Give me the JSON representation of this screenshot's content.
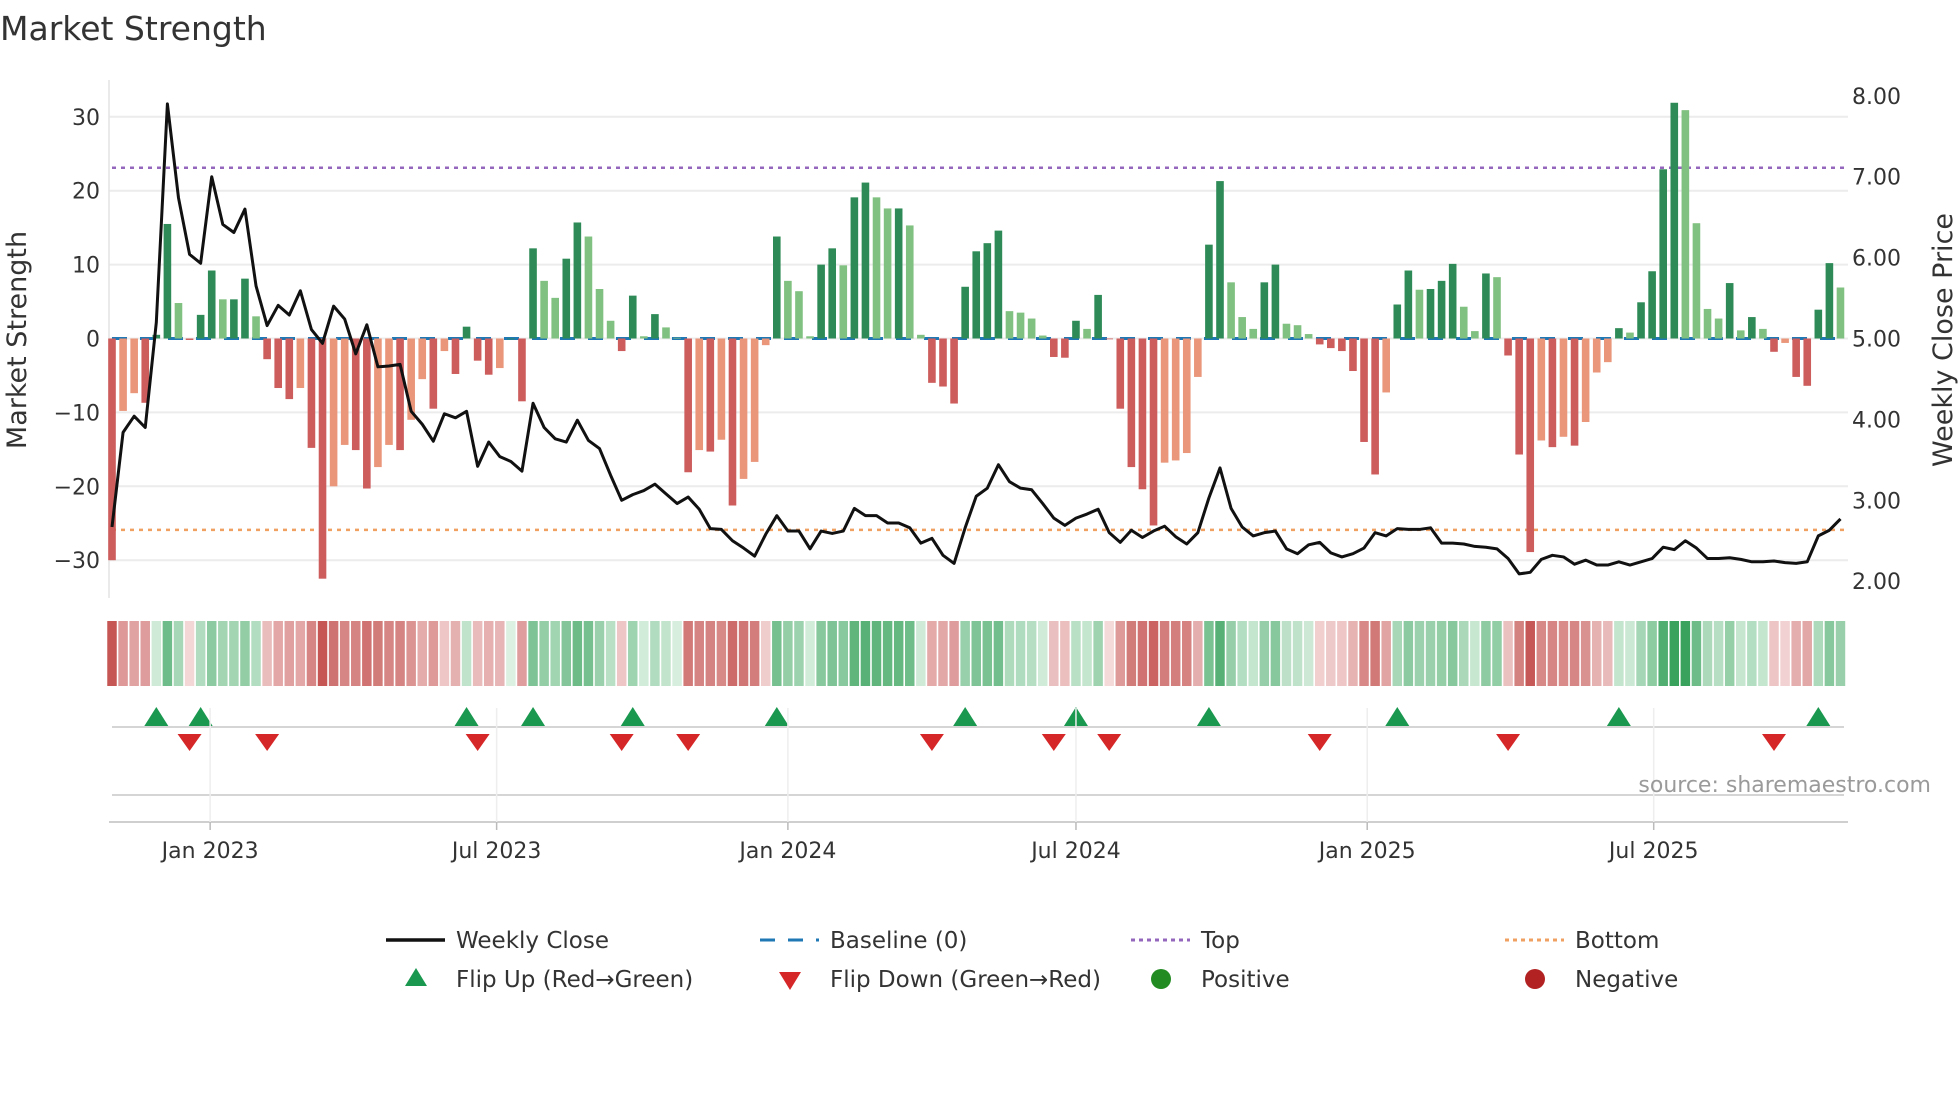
{
  "chart_data": {
    "type": "bar",
    "title": "Market Strength",
    "ylabel": "Market Strength",
    "y2label": "Weekly Close Price",
    "ylim": [
      -35,
      35
    ],
    "y2lim": [
      1.7,
      8.3
    ],
    "x_start_date": "2022-10-31",
    "x_interval": "weekly",
    "yticks": [
      30,
      20,
      10,
      0,
      -10,
      -20,
      -30
    ],
    "ytick_labels": [
      "30",
      "20",
      "10",
      "0",
      "−10",
      "−20",
      "−30"
    ],
    "y2ticks": [
      8,
      7,
      6,
      5,
      4,
      3,
      2
    ],
    "y2tick_labels": [
      "8.00",
      "7.00",
      "6.00",
      "5.00",
      "4.00",
      "3.00",
      "2.00"
    ],
    "xticks": [
      {
        "date": "2023-01-01",
        "label": "Jan 2023"
      },
      {
        "date": "2023-07-01",
        "label": "Jul 2023"
      },
      {
        "date": "2024-01-01",
        "label": "Jan 2024"
      },
      {
        "date": "2024-07-01",
        "label": "Jul 2024"
      },
      {
        "date": "2025-01-01",
        "label": "Jan 2025"
      },
      {
        "date": "2025-07-01",
        "label": "Jul 2025"
      }
    ],
    "top_level": 23.1,
    "bottom_level": -25.9,
    "baseline": 0,
    "strength": [
      -30,
      -9.8,
      -7.4,
      -8.7,
      0.5,
      15.5,
      4.8,
      -0.2,
      3.2,
      9.2,
      5.3,
      5.3,
      8.1,
      3.0,
      -2.8,
      -6.7,
      -8.2,
      -6.7,
      -14.8,
      -32.5,
      -20,
      -14.4,
      -15.1,
      -20.3,
      -17.4,
      -14.4,
      -15.1,
      -11,
      -5.5,
      -9.5,
      -1.7,
      -4.8,
      1.6,
      -3,
      -4.9,
      -4,
      0,
      -8.5,
      12.2,
      7.8,
      5.5,
      10.8,
      15.7,
      13.8,
      6.7,
      2.4,
      -1.7,
      5.8,
      0.3,
      3.3,
      1.5,
      0.1,
      -18.1,
      -15.1,
      -15.3,
      -13.7,
      -22.6,
      -19,
      -16.7,
      -0.9,
      13.8,
      7.8,
      6.4,
      0.3,
      10,
      12.2,
      9.9,
      19.1,
      21.1,
      19.1,
      17.6,
      17.6,
      15.3,
      0.5,
      -6.0,
      -6.5,
      -8.8,
      7.0,
      11.8,
      12.9,
      14.6,
      3.7,
      3.5,
      2.7,
      0.4,
      -2.5,
      -2.6,
      2.4,
      1.3,
      5.9,
      -0.1,
      -9.5,
      -17.4,
      -20.4,
      -25.3,
      -16.8,
      -16.5,
      -15.5,
      -5.2,
      12.7,
      21.3,
      7.6,
      2.9,
      1.3,
      7.6,
      10,
      2,
      1.8,
      0.6,
      -0.8,
      -1.3,
      -1.7,
      -4.4,
      -14,
      -18.4,
      -7.3,
      4.6,
      9.2,
      6.6,
      6.7,
      7.8,
      10.1,
      4.3,
      1,
      8.8,
      8.3,
      -2.3,
      -15.7,
      -28.9,
      -13.8,
      -14.7,
      -13.3,
      -14.5,
      -11.3,
      -4.6,
      -3.2,
      1.4,
      0.8,
      4.9,
      9.1,
      22.9,
      31.9,
      30.9,
      15.6,
      4,
      2.7,
      7.5,
      1.1,
      2.9,
      1.3,
      -1.8,
      -0.6,
      -5.2,
      -6.4,
      3.9,
      10.2,
      6.9
    ],
    "close": [
      2.67,
      3.84,
      4.04,
      3.9,
      5.2,
      7.9,
      6.74,
      6.04,
      5.93,
      7.0,
      6.41,
      6.31,
      6.6,
      5.65,
      5.16,
      5.41,
      5.29,
      5.59,
      5.11,
      4.94,
      5.4,
      5.24,
      4.81,
      5.17,
      4.65,
      4.66,
      4.68,
      4.1,
      3.94,
      3.73,
      4.07,
      4.02,
      4.1,
      3.42,
      3.72,
      3.54,
      3.48,
      3.36,
      4.2,
      3.9,
      3.76,
      3.72,
      3.99,
      3.74,
      3.64,
      3.31,
      3.0,
      3.07,
      3.12,
      3.2,
      3.08,
      2.96,
      3.04,
      2.89,
      2.65,
      2.64,
      2.5,
      2.41,
      2.31,
      2.58,
      2.81,
      2.62,
      2.62,
      2.4,
      2.62,
      2.59,
      2.62,
      2.9,
      2.81,
      2.81,
      2.72,
      2.72,
      2.66,
      2.47,
      2.53,
      2.32,
      2.22,
      2.66,
      3.05,
      3.15,
      3.44,
      3.23,
      3.15,
      3.13,
      2.96,
      2.78,
      2.69,
      2.78,
      2.83,
      2.89,
      2.6,
      2.48,
      2.63,
      2.54,
      2.62,
      2.68,
      2.55,
      2.46,
      2.6,
      3.03,
      3.4,
      2.9,
      2.67,
      2.56,
      2.6,
      2.62,
      2.4,
      2.34,
      2.45,
      2.48,
      2.35,
      2.3,
      2.34,
      2.41,
      2.6,
      2.56,
      2.65,
      2.64,
      2.64,
      2.66,
      2.47,
      2.47,
      2.46,
      2.43,
      2.42,
      2.4,
      2.28,
      2.09,
      2.11,
      2.27,
      2.32,
      2.3,
      2.21,
      2.26,
      2.2,
      2.2,
      2.24,
      2.2,
      2.24,
      2.28,
      2.42,
      2.39,
      2.5,
      2.41,
      2.28,
      2.28,
      2.29,
      2.27,
      2.24,
      2.24,
      2.25,
      2.23,
      2.22,
      2.24,
      2.56,
      2.63,
      2.77
    ],
    "flip_up_weeks": [
      4,
      8,
      32,
      38,
      47,
      60,
      77,
      87,
      99,
      116,
      136,
      154
    ],
    "flip_down_weeks": [
      7,
      14,
      33,
      46,
      52,
      74,
      85,
      90,
      109,
      126,
      150
    ],
    "legend": [
      {
        "label": "Weekly Close",
        "symbol": "line"
      },
      {
        "label": "Baseline (0)",
        "symbol": "dash"
      },
      {
        "label": "Top",
        "symbol": "dot-purple"
      },
      {
        "label": "Bottom",
        "symbol": "dot-orange"
      },
      {
        "label": "Flip Up (Red→Green)",
        "symbol": "triangle-up"
      },
      {
        "label": "Flip Down (Green→Red)",
        "symbol": "triangle-down"
      },
      {
        "label": "Positive",
        "symbol": "circle-green"
      },
      {
        "label": "Negative",
        "symbol": "circle-red"
      }
    ],
    "legend_placement": "bottom",
    "grid": true,
    "source": "source: sharemaestro.com"
  },
  "colors": {
    "pos_strong": "#2e8b57",
    "pos_weak": "#80c080",
    "neg_strong": "#cd5c5c",
    "neg_weak": "#e9967a",
    "close": "#111111",
    "baseline": "#1f77b4",
    "top": "#9467bd",
    "bottom": "#f0a060",
    "flip_up": "#1a9850",
    "flip_down": "#d62728",
    "positive": "#228b22",
    "negative": "#b22222"
  }
}
